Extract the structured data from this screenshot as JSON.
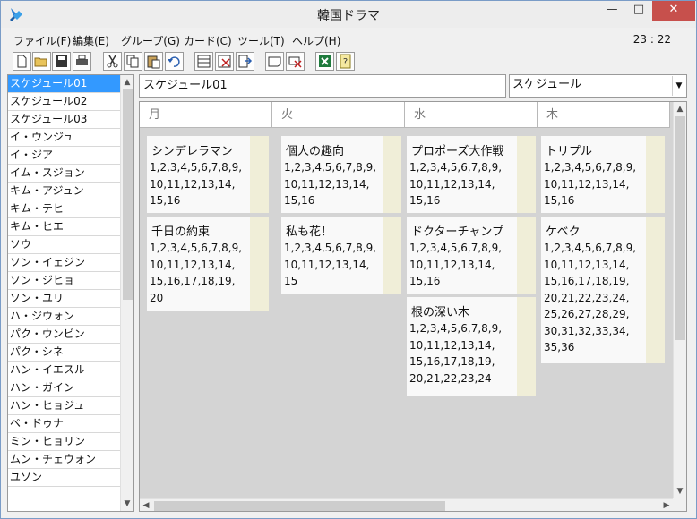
{
  "window": {
    "title": "韓国ドラマ"
  },
  "menu": [
    "ファイル(F)",
    "編集(E)",
    "グループ(G)",
    "カード(C)",
    "ツール(T)",
    "ヘルプ(H)"
  ],
  "clock": "23 : 22",
  "toolbar": {
    "icons": [
      "new-file-icon",
      "open-folder-icon",
      "save-icon",
      "print-icon",
      "cut-icon",
      "copy-icon",
      "paste-icon",
      "undo-icon",
      "card-list-icon",
      "card-delete-icon",
      "card-move-icon",
      "group-icon",
      "group-delete-icon",
      "excel-icon",
      "help-icon"
    ]
  },
  "sidebar": {
    "items": [
      "スケジュール01",
      "スケジュール02",
      "スケジュール03",
      "イ・ウンジュ",
      "イ・ジア",
      "イム・スジョン",
      "キム・アジュン",
      "キム・テヒ",
      "キム・ヒエ",
      "ソウ",
      "ソン・イェジン",
      "ソン・ジヒョ",
      "ソン・ユリ",
      "ハ・ジウォン",
      "パク・ウンビン",
      "パク・シネ",
      "ハン・イエスル",
      "ハン・ガイン",
      "ハン・ヒョジュ",
      "ペ・ドゥナ",
      "ミン・ヒョリン",
      "ムン・チェウォン",
      "ユソン"
    ]
  },
  "schedule_name": "スケジュール01",
  "view_select": "スケジュール",
  "columns": [
    "月",
    "火",
    "水",
    "木"
  ],
  "cards": {
    "mon1": {
      "title": "シンデレラマン",
      "body": "1,2,3,4,5,6,7,8,9,\n10,11,12,13,14,\n15,16"
    },
    "mon2": {
      "title": "千日の約束",
      "body": "1,2,3,4,5,6,7,8,9,\n10,11,12,13,14,\n15,16,17,18,19,\n20"
    },
    "tue1": {
      "title": "個人の趣向",
      "body": "1,2,3,4,5,6,7,8,9,\n10,11,12,13,14,\n15,16"
    },
    "tue2": {
      "title": "私も花！",
      "body": "1,2,3,4,5,6,7,8,9,\n10,11,12,13,14,\n15"
    },
    "wed1": {
      "title": "プロポーズ大作戦",
      "body": "1,2,3,4,5,6,7,8,9,\n10,11,12,13,14,\n15,16"
    },
    "wed2": {
      "title": "ドクターチャンプ",
      "body": "1,2,3,4,5,6,7,8,9,\n10,11,12,13,14,\n15,16"
    },
    "wed3": {
      "title": "根の深い木",
      "body": "1,2,3,4,5,6,7,8,9,\n10,11,12,13,14,\n15,16,17,18,19,\n20,21,22,23,24"
    },
    "thu1": {
      "title": "トリプル",
      "body": "1,2,3,4,5,6,7,8,9,\n10,11,12,13,14,\n15,16"
    },
    "thu2": {
      "title": "ケベク",
      "body": "1,2,3,4,5,6,7,8,9,\n10,11,12,13,14,\n15,16,17,18,19,\n20,21,22,23,24,\n25,26,27,28,29,\n30,31,32,33,34,\n35,36"
    }
  }
}
